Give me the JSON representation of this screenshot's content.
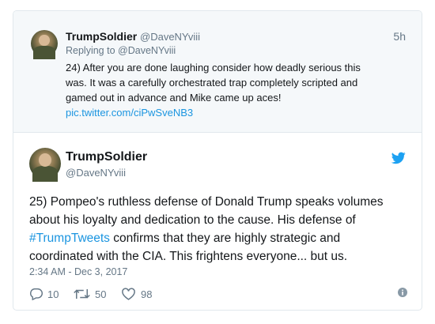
{
  "parent_tweet": {
    "name": "TrumpSoldier",
    "handle": "@DaveNYviii",
    "time": "5h",
    "reply_prefix": "Replying to",
    "reply_to": "@DaveNYviii",
    "lines": [
      "24) After you are done laughing consider how deadly serious this",
      "was. It was a carefully orchestrated trap completely scripted and",
      "gamed out in advance and Mike came up aces!"
    ],
    "link": "pic.twitter.com/ciPwSveNB3"
  },
  "main_tweet": {
    "name": "TrumpSoldier",
    "handle": "@DaveNYviii",
    "line1": "25) Pompeo's ruthless defense of Donald Trump speaks volumes",
    "line2": "about his loyalty and dedication to the cause. His defense of",
    "hashtag": "#TrumpTweets",
    "line3_rest": " confirms that they are highly strategic and",
    "line4": "coordinated with the CIA. This frightens everyone... but us.",
    "timestamp": "2:34 AM - Dec 3, 2017",
    "replies": "10",
    "retweets": "50",
    "likes": "98"
  },
  "icons": {
    "bird": "twitter-bird-icon",
    "reply": "reply-icon",
    "retweet": "retweet-icon",
    "like": "heart-icon",
    "info": "info-icon"
  },
  "colors": {
    "link": "#1b95e0",
    "muted": "#657786",
    "background_parent": "#f5f8fa"
  }
}
